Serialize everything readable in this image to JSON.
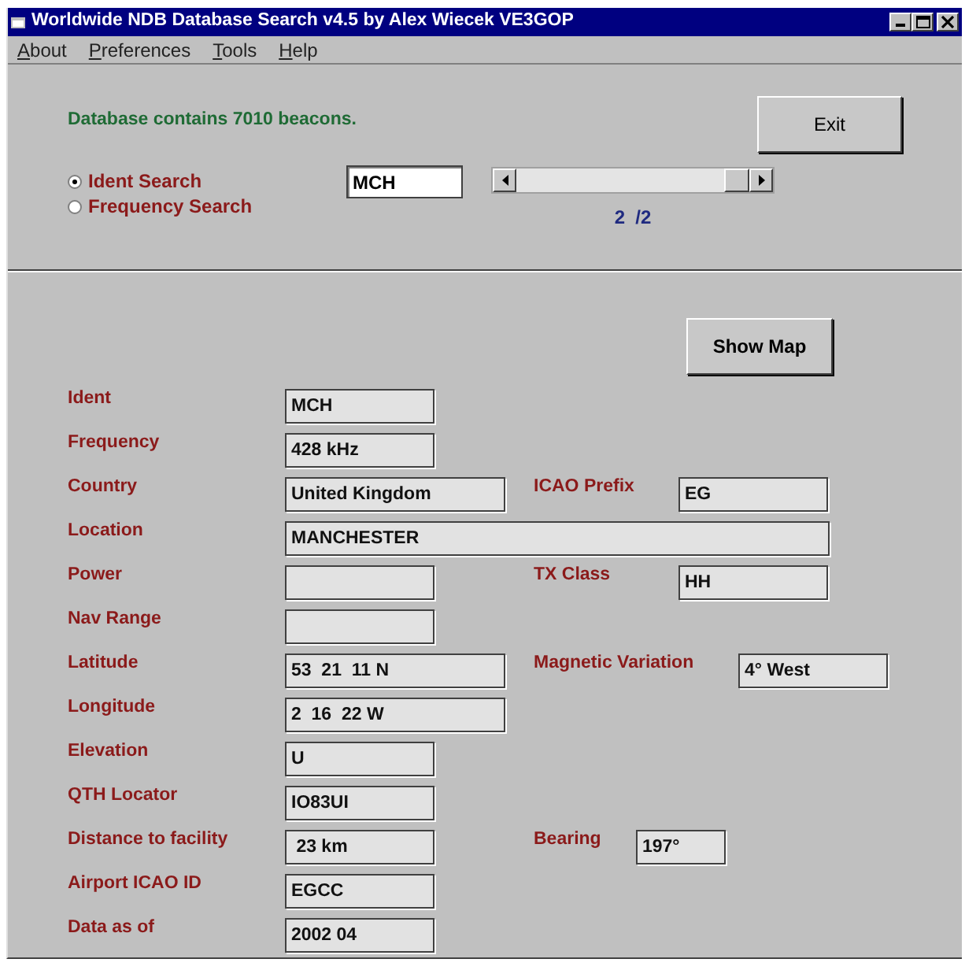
{
  "window": {
    "title": "Worldwide NDB Database Search v4.5 by Alex Wiecek VE3GOP"
  },
  "menu": [
    "About",
    "Preferences",
    "Tools",
    "Help"
  ],
  "status": "Database contains  7010 beacons.",
  "exit_button": "Exit",
  "search_modes": [
    {
      "label": "Ident Search",
      "selected": true
    },
    {
      "label": "Frequency Search",
      "selected": false
    }
  ],
  "search_field": {
    "value": "MCH"
  },
  "result_counter": "2  /2",
  "show_map_button": "Show Map",
  "fields": [
    {
      "label": "Ident",
      "value": "MCH",
      "kind": "short"
    },
    {
      "label": "Frequency",
      "value": "428 kHz",
      "kind": "short"
    },
    {
      "label": "Country",
      "value": "United Kingdom",
      "kind": "medium",
      "side": {
        "label": "ICAO Prefix",
        "value": "EG",
        "kind": "prefix"
      }
    },
    {
      "label": "Location",
      "value": "MANCHESTER",
      "kind": "wide"
    },
    {
      "label": "Power",
      "kind": "short",
      "side": {
        "label": "TX Class",
        "value": "HH",
        "kind": "prefix"
      }
    },
    {
      "label": "Nav Range",
      "kind": "short"
    },
    {
      "label": "Latitude",
      "value": "53  21  11 N",
      "kind": "medium",
      "side": {
        "label": "Magnetic Variation",
        "value": "4° West",
        "kind": "variation"
      }
    },
    {
      "label": "Longitude",
      "value": "2  16  22 W",
      "kind": "medium"
    },
    {
      "label": "Elevation",
      "value": "U",
      "kind": "short"
    },
    {
      "label": "QTH Locator",
      "value": "IO83UI",
      "kind": "short"
    },
    {
      "label": "Distance to facility",
      "value": " 23 km",
      "kind": "short",
      "side": {
        "label": "Bearing",
        "value": "197°",
        "kind": "bearing"
      }
    },
    {
      "label": "Airport ICAO ID",
      "value": "EGCC",
      "kind": "short"
    },
    {
      "label": "Data as of",
      "value": "2002 04",
      "kind": "short"
    }
  ]
}
